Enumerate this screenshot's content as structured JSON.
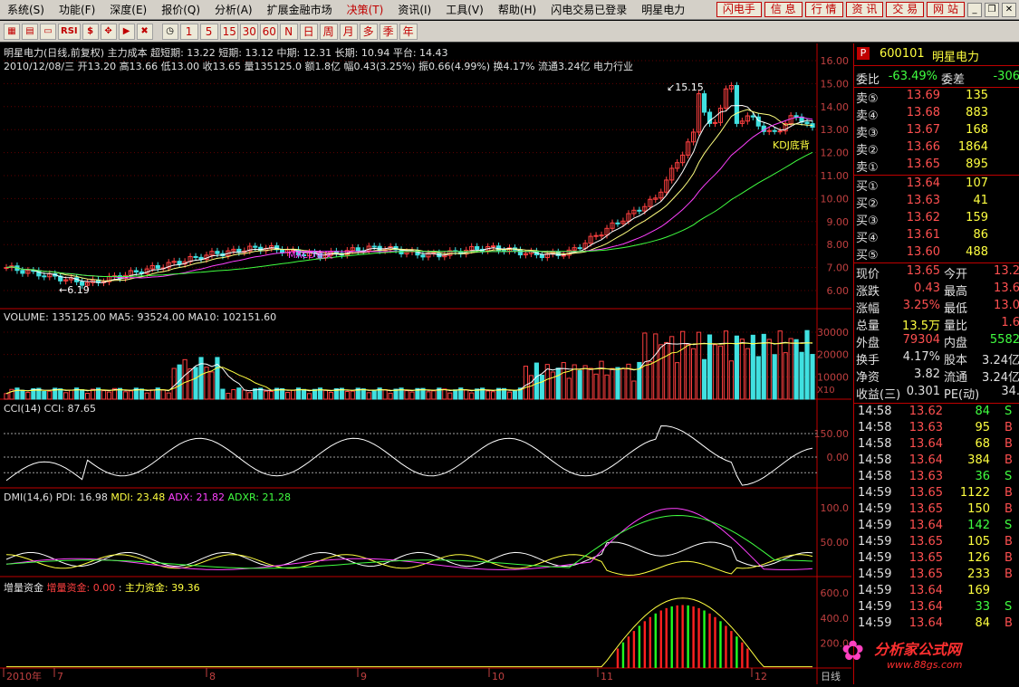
{
  "menu": [
    {
      "label": "系统(S)",
      "red": false
    },
    {
      "label": "功能(F)",
      "red": false
    },
    {
      "label": "深度(E)",
      "red": false
    },
    {
      "label": "报价(Q)",
      "red": false
    },
    {
      "label": "分析(A)",
      "red": false
    },
    {
      "label": "扩展金融市场",
      "red": false
    },
    {
      "label": "决策(T)",
      "red": true
    },
    {
      "label": "资讯(I)",
      "red": false
    },
    {
      "label": "工具(V)",
      "red": false
    },
    {
      "label": "帮助(H)",
      "red": false
    },
    {
      "label": "闪电交易已登录",
      "red": false
    },
    {
      "label": "明星电力",
      "red": false
    }
  ],
  "right_buttons": [
    "闪电手",
    "信 息",
    "行 情",
    "资 讯",
    "交 易",
    "网 站"
  ],
  "toolbar_icons": [
    "▦",
    "▤",
    "▭",
    "RSI",
    "$",
    "✥",
    "▶",
    "✖"
  ],
  "toolbar_periods": [
    "1",
    "5",
    "15",
    "30",
    "60",
    "N",
    "日",
    "周",
    "月",
    "多",
    "季",
    "年"
  ],
  "price_panel": {
    "title_line1": "明星电力(日线,前复权) 主力成本  超短期: 13.22  短期: 13.12  中期: 12.31  长期: 10.94      平台: 14.43",
    "title_line2": "2010/12/08/三 开13.20 高13.66 低13.00 收13.65 量135125.0 额1.8亿 幅0.43(3.25%) 振0.66(4.99%) 换4.17% 流通3.24亿  电力行业",
    "y_ticks": [
      "16.00",
      "15.00",
      "14.00",
      "13.00",
      "12.00",
      "11.00",
      "10.00",
      "9.00",
      "8.00",
      "7.00",
      "6.00"
    ],
    "high_label": "15.15",
    "low_label": "6.19",
    "kdj_label": "KDJ底背",
    "text_marker": "MACD金叉"
  },
  "volume_panel": {
    "title": "VOLUME: 135125.00  MA5: 93524.00  MA10: 102151.60",
    "y_ticks": [
      "30000",
      "20000",
      "10000"
    ],
    "unit": "X10"
  },
  "cci_panel": {
    "title": "CCI(14)  CCI: 87.65",
    "y_ticks": [
      "150.00",
      "0.00"
    ]
  },
  "dmi_panel": {
    "title_prefix": "DMI(14,6)",
    "pdi": "PDI: 16.98",
    "mdi": "MDI: 23.48",
    "adx": "ADX: 21.82",
    "adxr": "ADXR: 21.28",
    "y_ticks": [
      "100.0",
      "50.00"
    ]
  },
  "fund_panel": {
    "title": "增量资金",
    "inc": "增量资金: 0.00",
    "sep": ":",
    "main": "主力资金: 39.36",
    "y_ticks": [
      "600.0",
      "400.0",
      "200.0"
    ]
  },
  "x_axis": [
    "2010年",
    "7",
    "8",
    "9",
    "10",
    "11",
    "12"
  ],
  "x_axis_right": "日线",
  "quote": {
    "code": "600101",
    "name": "明星电力",
    "weibi_label": "委比",
    "weibi": "-63.49%",
    "weicha_label": "委差",
    "weicha": "-306",
    "sell": [
      {
        "label": "卖⑤",
        "price": "13.69",
        "vol": "135"
      },
      {
        "label": "卖④",
        "price": "13.68",
        "vol": "883"
      },
      {
        "label": "卖③",
        "price": "13.67",
        "vol": "168"
      },
      {
        "label": "卖②",
        "price": "13.66",
        "vol": "1864"
      },
      {
        "label": "卖①",
        "price": "13.65",
        "vol": "895"
      }
    ],
    "buy": [
      {
        "label": "买①",
        "price": "13.64",
        "vol": "107"
      },
      {
        "label": "买②",
        "price": "13.63",
        "vol": "41"
      },
      {
        "label": "买③",
        "price": "13.62",
        "vol": "159"
      },
      {
        "label": "买④",
        "price": "13.61",
        "vol": "86"
      },
      {
        "label": "买⑤",
        "price": "13.60",
        "vol": "488"
      }
    ],
    "stats": [
      {
        "l1": "现价",
        "v1": "13.65",
        "c1": "red",
        "l2": "今开",
        "v2": "13.2",
        "c2": "red"
      },
      {
        "l1": "涨跌",
        "v1": "0.43",
        "c1": "red",
        "l2": "最高",
        "v2": "13.6",
        "c2": "red"
      },
      {
        "l1": "涨幅",
        "v1": "3.25%",
        "c1": "red",
        "l2": "最低",
        "v2": "13.0",
        "c2": "red"
      },
      {
        "l1": "总量",
        "v1": "13.5万",
        "c1": "yel",
        "l2": "量比",
        "v2": "1.6",
        "c2": "red"
      },
      {
        "l1": "外盘",
        "v1": "79304",
        "c1": "red",
        "l2": "内盘",
        "v2": "5582",
        "c2": "grn"
      },
      {
        "l1": "换手",
        "v1": "4.17%",
        "c1": "wht",
        "l2": "股本",
        "v2": "3.24亿",
        "c2": "wht"
      },
      {
        "l1": "净资",
        "v1": "3.82",
        "c1": "wht",
        "l2": "流通",
        "v2": "3.24亿",
        "c2": "wht"
      },
      {
        "l1": "收益(三)",
        "v1": "0.301",
        "c1": "wht",
        "l2": "PE(动)",
        "v2": "34.",
        "c2": "wht"
      }
    ],
    "ticks": [
      {
        "time": "14:58",
        "price": "13.62",
        "vol": "84",
        "bs": "S"
      },
      {
        "time": "14:58",
        "price": "13.63",
        "vol": "95",
        "bs": "B"
      },
      {
        "time": "14:58",
        "price": "13.64",
        "vol": "68",
        "bs": "B"
      },
      {
        "time": "14:58",
        "price": "13.64",
        "vol": "384",
        "bs": "B"
      },
      {
        "time": "14:58",
        "price": "13.63",
        "vol": "36",
        "bs": "S"
      },
      {
        "time": "14:59",
        "price": "13.65",
        "vol": "1122",
        "bs": "B"
      },
      {
        "time": "14:59",
        "price": "13.65",
        "vol": "150",
        "bs": "B"
      },
      {
        "time": "14:59",
        "price": "13.64",
        "vol": "142",
        "bs": "S"
      },
      {
        "time": "14:59",
        "price": "13.65",
        "vol": "105",
        "bs": "B"
      },
      {
        "time": "14:59",
        "price": "13.65",
        "vol": "126",
        "bs": "B"
      },
      {
        "time": "14:59",
        "price": "13.65",
        "vol": "233",
        "bs": "B"
      },
      {
        "time": "14:59",
        "price": "13.64",
        "vol": "169",
        "bs": ""
      },
      {
        "time": "14:59",
        "price": "13.64",
        "vol": "33",
        "bs": "S"
      },
      {
        "time": "14:59",
        "price": "13.64",
        "vol": "84",
        "bs": "B"
      }
    ]
  },
  "watermark": {
    "text": "分析家公式网",
    "url": "www.88gs.com"
  },
  "colors": {
    "up": "#ff4040",
    "down": "#40e0e0",
    "ma1": "#ffffff",
    "ma2": "#ffff80",
    "ma3": "#ff40ff",
    "ma4": "#40ff40"
  }
}
